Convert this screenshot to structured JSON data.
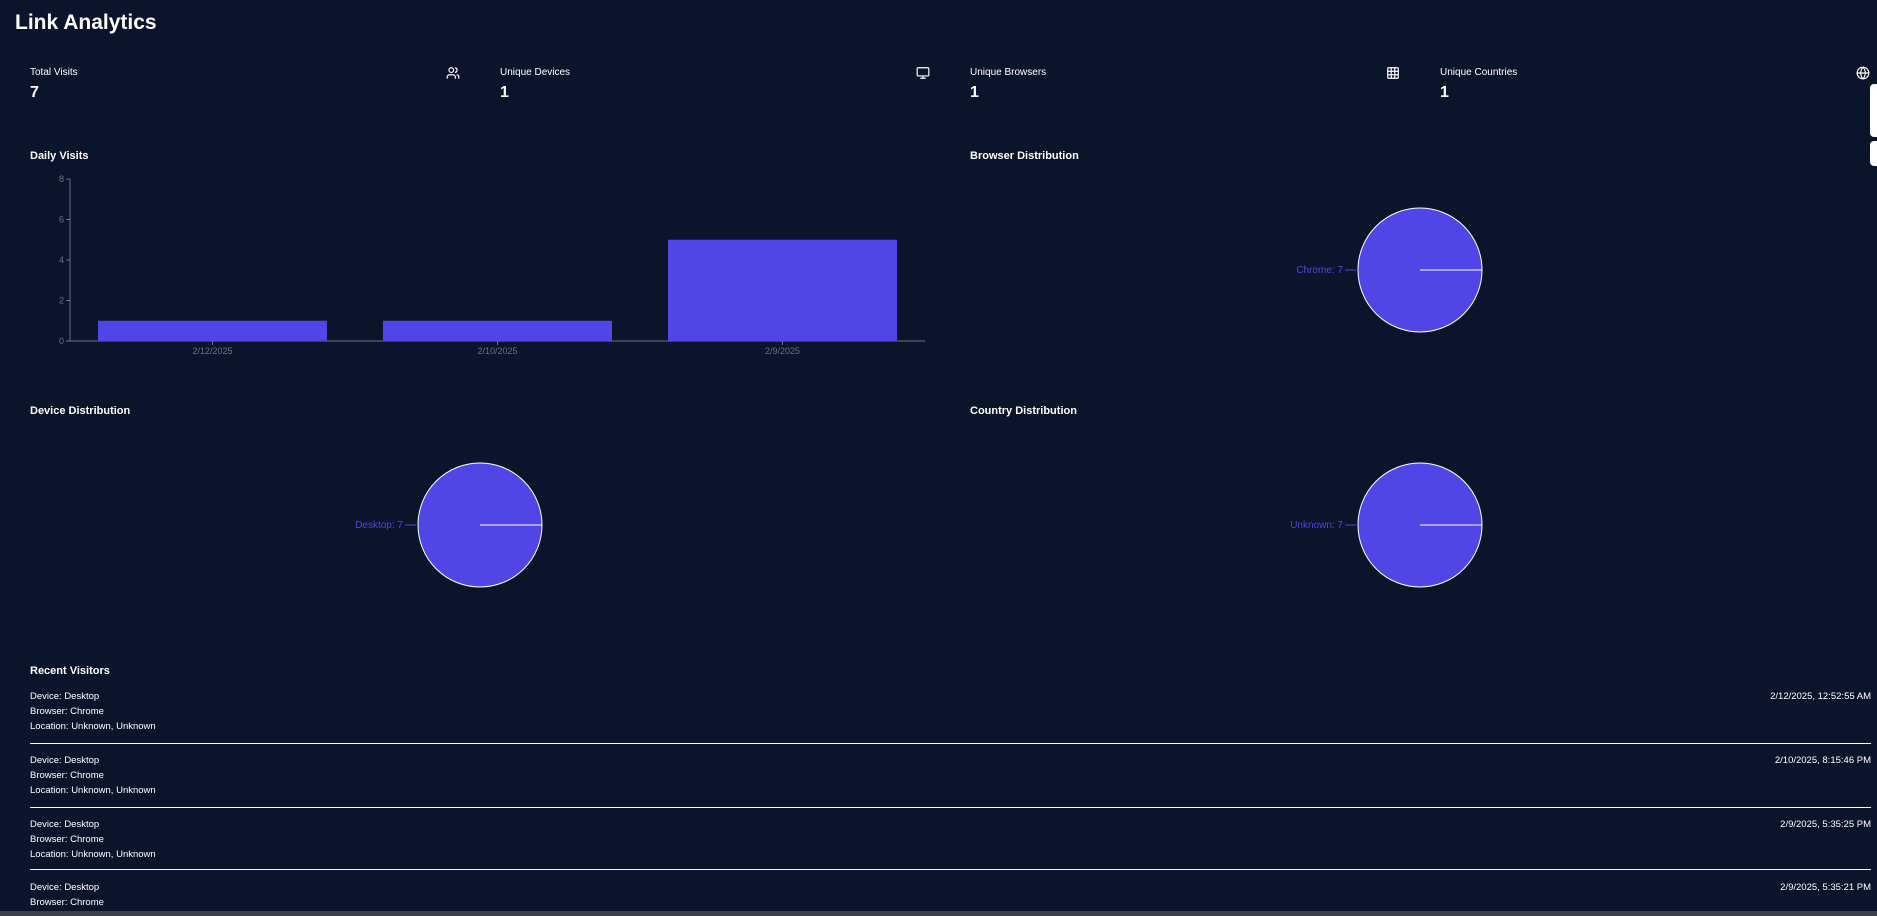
{
  "page": {
    "title": "Link Analytics"
  },
  "stats": [
    {
      "label": "Total Visits",
      "value": "7",
      "icon": "users-icon"
    },
    {
      "label": "Unique Devices",
      "value": "1",
      "icon": "monitor-icon"
    },
    {
      "label": "Unique Browsers",
      "value": "1",
      "icon": "grid-icon"
    },
    {
      "label": "Unique Countries",
      "value": "1",
      "icon": "globe-icon"
    }
  ],
  "daily_visits": {
    "title": "Daily Visits",
    "chart_data": {
      "type": "bar",
      "categories": [
        "2/12/2025",
        "2/10/2025",
        "2/9/2025"
      ],
      "values": [
        1,
        1,
        5
      ],
      "ylim": [
        0,
        8
      ],
      "yticks": [
        "0",
        "2",
        "4",
        "6",
        "8"
      ],
      "bar_color": "#4f46e5"
    }
  },
  "browser_distribution": {
    "title": "Browser Distribution",
    "chart_data": {
      "type": "pie",
      "slices": [
        {
          "label": "Chrome: 7",
          "value": 7
        }
      ],
      "color": "#4f46e5"
    }
  },
  "device_distribution": {
    "title": "Device Distribution",
    "chart_data": {
      "type": "pie",
      "slices": [
        {
          "label": "Desktop: 7",
          "value": 7
        }
      ],
      "color": "#4f46e5"
    }
  },
  "country_distribution": {
    "title": "Country Distribution",
    "chart_data": {
      "type": "pie",
      "slices": [
        {
          "label": "Unknown: 7",
          "value": 7
        }
      ],
      "color": "#4f46e5"
    }
  },
  "recent_visitors": {
    "title": "Recent Visitors",
    "items": [
      {
        "device": "Device: Desktop",
        "browser": "Browser: Chrome",
        "location": "Location: Unknown, Unknown",
        "time": "2/12/2025, 12:52:55 AM"
      },
      {
        "device": "Device: Desktop",
        "browser": "Browser: Chrome",
        "location": "Location: Unknown, Unknown",
        "time": "2/10/2025, 8:15:46 PM"
      },
      {
        "device": "Device: Desktop",
        "browser": "Browser: Chrome",
        "location": "Location: Unknown, Unknown",
        "time": "2/9/2025, 5:35:25 PM"
      },
      {
        "device": "Device: Desktop",
        "browser": "Browser: Chrome",
        "location": "",
        "time": "2/9/2025, 5:35:21 PM"
      }
    ]
  },
  "colors": {
    "background": "#0a142a",
    "accent": "#4f46e5",
    "text": "#ffffff",
    "axis": "#6b7280"
  }
}
